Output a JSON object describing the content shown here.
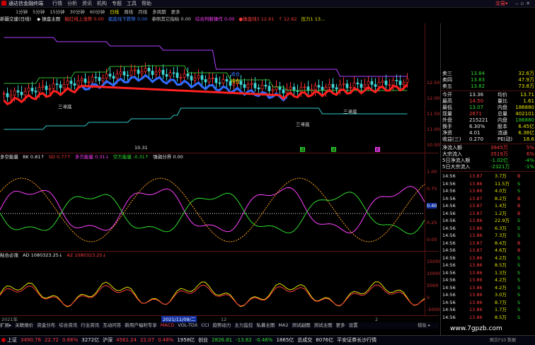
{
  "app": {
    "title": "通达信金融终端",
    "right_label": "交易▾"
  },
  "menu": {
    "items": [
      "行情",
      "分析",
      "资讯",
      "机构",
      "专题",
      "工具",
      "帮助"
    ],
    "periods": [
      "1分钟",
      "5分钟",
      "15分钟",
      "30分钟",
      "60分钟",
      "日线",
      "周线",
      "月线",
      "多周期",
      "更多"
    ],
    "code": "L112"
  },
  "info_line": {
    "stock": "新疆交建(日线)",
    "segments": [
      {
        "text": "◆ 操盘主图",
        "color": "#e6e6e6"
      },
      {
        "text": "粗红线上涨势 0.00",
        "color": "#ff3b3b"
      },
      {
        "text": "粗蓝线下跌势 0.00",
        "color": "#3c7cff"
      },
      {
        "text": "参照其它指标 0.00",
        "color": "#c8c8c8"
      },
      {
        "text": "综合判断操作 0.00",
        "color": "#ff40ff"
      },
      {
        "text": "●操盘线3 12.61",
        "color": "#ff3b3b"
      },
      {
        "text": "↑ 12.62",
        "color": "#ff3b3b"
      },
      {
        "text": "压力1 13...",
        "color": "#e6e600"
      }
    ]
  },
  "main_chart": {
    "price_ticks": [
      "12.50",
      "12.00",
      "11.50",
      "11.00",
      "10.50"
    ],
    "annotations": [
      {
        "text": "三寻底",
        "color": "#e6e6e6"
      },
      {
        "text": "三寻底",
        "color": "#e6e6e6"
      },
      {
        "text": "三寻底",
        "color": "#e6e6e6"
      },
      {
        "text": "减仓",
        "color": "#3c7cff"
      },
      {
        "text": "持仓",
        "color": "#e6e600"
      },
      {
        "text": "10.31",
        "color": "#e6e6e6"
      }
    ],
    "signals": [
      {
        "text": "减",
        "color": "#2fdc2f"
      },
      {
        "text": "减",
        "color": "#2fdc2f"
      },
      {
        "text": "卖",
        "color": "#ff40ff"
      }
    ]
  },
  "sub1": {
    "title": "多空能量",
    "fields": [
      {
        "text": "BK 0.81↑",
        "color": "#e6e6e6"
      },
      {
        "text": "SD 0.77↑",
        "color": "#ff3b3b"
      },
      {
        "text": "多方能量 0.31↓",
        "color": "#ff40ff"
      },
      {
        "text": "空方能量 -0.31↑",
        "color": "#2fdc2f"
      },
      {
        "text": "强弱分界 0.00",
        "color": "#e6e6e6"
      }
    ],
    "ticks": [
      "1.00",
      "0.75",
      "0.40",
      "0.25",
      "0.00"
    ]
  },
  "sub2": {
    "title": "粘合必涨",
    "fields": [
      {
        "text": "AD 1080323.25↓",
        "color": "#e6e6e6"
      },
      {
        "text": "AZ 1080323.25↓",
        "color": "#ff3b3b"
      }
    ],
    "ticks": [
      "15000",
      "10000",
      "5000",
      "0",
      "-5000"
    ]
  },
  "x_axis": {
    "labels": [
      "2021年",
      "2021/11/09/二",
      "12",
      "2"
    ]
  },
  "quote_panel": {
    "asks": [
      {
        "label": "卖三",
        "price": "13.84",
        "vol": "32.6万"
      },
      {
        "label": "卖四",
        "price": "13.83",
        "vol": "47.9万"
      },
      {
        "label": "卖五",
        "price": "13.82",
        "vol": "73.8万"
      }
    ],
    "stats": [
      {
        "k1": "今开",
        "v1": "13.36",
        "k2": "均价",
        "v2": "13.71"
      },
      {
        "k1": "最高",
        "v1": "14.50",
        "k2": "量比",
        "v2": "1.61"
      },
      {
        "k1": "最低",
        "v1": "13.07",
        "k2": "内盘",
        "v2": "186880"
      },
      {
        "k1": "现量",
        "v1": "2671",
        "k2": "总量",
        "v2": "402101"
      },
      {
        "k1": "外盘",
        "v1": "215221",
        "k2": "内盘",
        "v2": "186880"
      },
      {
        "k1": "换手",
        "v1": "6.30%",
        "k2": "股本",
        "v2": "6.45亿"
      },
      {
        "k1": "净资",
        "v1": "4.01",
        "k2": "流通",
        "v2": "6.38亿"
      },
      {
        "k1": "收益(三)",
        "v1": "0.270",
        "k2": "PE(动)",
        "v2": "18.6"
      }
    ],
    "flows": [
      {
        "label": "净流入额",
        "val": "3945万",
        "pct": "5%"
      },
      {
        "label": "大宗流入",
        "val": "3519万",
        "pct": "6%"
      },
      {
        "label": "5日净流入额",
        "val": "-1.02亿",
        "pct": "-4%"
      },
      {
        "label": "5日大宗流入",
        "val": "-2321万",
        "pct": "-1%"
      }
    ],
    "ticks": [
      {
        "t": "14:56",
        "p": "13.87",
        "v": "3.7万",
        "d": "B"
      },
      {
        "t": "14:56",
        "p": "13.86",
        "v": "11.5万",
        "d": "S"
      },
      {
        "t": "14:56",
        "p": "13.86",
        "v": "4.0万",
        "d": "S"
      },
      {
        "t": "14:56",
        "p": "13.87",
        "v": "8.2万",
        "d": "B"
      },
      {
        "t": "14:56",
        "p": "13.87",
        "v": "1.4万",
        "d": "B"
      },
      {
        "t": "14:56",
        "p": "13.87",
        "v": "1.2万",
        "d": "B"
      },
      {
        "t": "14:56",
        "p": "13.86",
        "v": "22.9万",
        "d": "S"
      },
      {
        "t": "14:56",
        "p": "13.86",
        "v": "6.3万",
        "d": "S"
      },
      {
        "t": "14:56",
        "p": "13.86",
        "v": "7.3万",
        "d": "S"
      },
      {
        "t": "14:56",
        "p": "13.87",
        "v": "8.4万",
        "d": "B"
      },
      {
        "t": "14:56",
        "p": "13.87",
        "v": "4.6万",
        "d": "B"
      },
      {
        "t": "14:56",
        "p": "13.86",
        "v": "4.2万",
        "d": "S"
      },
      {
        "t": "14:56",
        "p": "13.86",
        "v": "8.5万",
        "d": "S"
      },
      {
        "t": "14:56",
        "p": "13.86",
        "v": "1.3万",
        "d": "S"
      },
      {
        "t": "14:56",
        "p": "13.86",
        "v": "4.2万",
        "d": "S"
      },
      {
        "t": "14:56",
        "p": "13.86",
        "v": "4.2万",
        "d": "S"
      },
      {
        "t": "14:56",
        "p": "13.86",
        "v": "3.0万",
        "d": "S"
      },
      {
        "t": "14:56",
        "p": "13.86",
        "v": "8.7万",
        "d": "S"
      },
      {
        "t": "14:56",
        "p": "13.86",
        "v": "1.7万",
        "d": "S"
      },
      {
        "t": "14:56",
        "p": "13.86",
        "v": "8.5万",
        "d": "S"
      }
    ]
  },
  "tabs": [
    "扩展▸",
    "关联报价",
    "资金分布",
    "综合资讯",
    "行业资讯",
    "互动问答",
    "新用户福利专享",
    "MACD",
    "VOL-TDX",
    "CCI",
    "趋势动力",
    "主力监控",
    "私募主图",
    "MA2",
    "测试副图",
    "测试主图",
    "更多",
    "设置"
  ],
  "tabs_right": "模板 ▸",
  "status": {
    "items": [
      {
        "text": "上证",
        "color": "#e6e6e6"
      },
      {
        "text": "3490.76",
        "color": "#ff3b3b"
      },
      {
        "text": "22.72",
        "color": "#ff3b3b"
      },
      {
        "text": "0.66%",
        "color": "#ff3b3b"
      },
      {
        "text": "3272亿",
        "color": "#e6e6e6"
      },
      {
        "text": "沪深",
        "color": "#e6e6e6"
      },
      {
        "text": "4561.24",
        "color": "#ff3b3b"
      },
      {
        "text": "22.07",
        "color": "#ff3b3b"
      },
      {
        "text": "0.48%",
        "color": "#ff3b3b"
      },
      {
        "text": "1958亿",
        "color": "#e6e6e6"
      },
      {
        "text": "创业",
        "color": "#e6e6e6"
      },
      {
        "text": "2826.81",
        "color": "#2fdc2f"
      },
      {
        "text": "-13.82",
        "color": "#2fdc2f"
      },
      {
        "text": "-0.46%",
        "color": "#2fdc2f"
      },
      {
        "text": "1865亿",
        "color": "#e6e6e6"
      },
      {
        "text": "总成交",
        "color": "#e6e6e6"
      },
      {
        "text": "8076亿",
        "color": "#e6e6e6"
      },
      {
        "text": "平安证券长沙行情",
        "color": "#e6e6e6"
      }
    ],
    "watermark": "www.7gpzb.com",
    "right_note": "图文F10 数据"
  }
}
